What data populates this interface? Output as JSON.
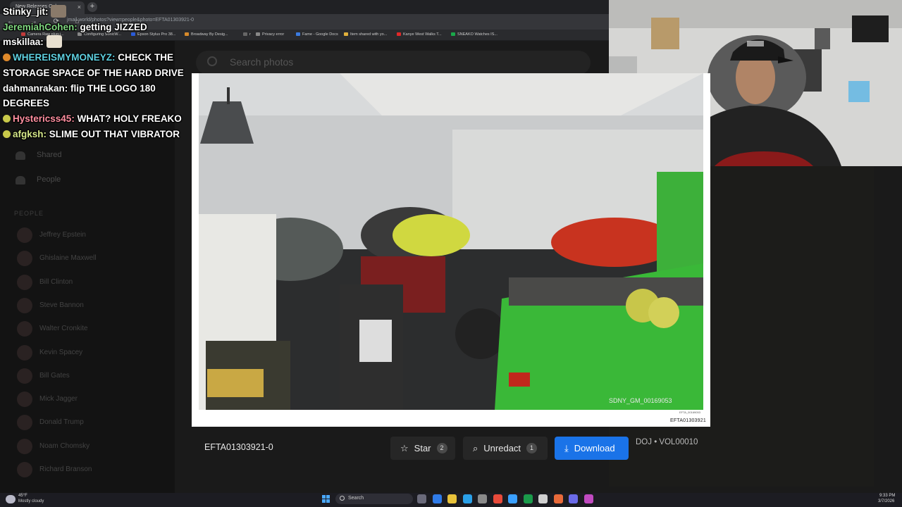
{
  "browser": {
    "tab_title": "New Releases Onl...",
    "new_tab_symbol": "+",
    "close_symbol": "×",
    "nav_symbols": "← → ⟳ ⌂",
    "url": "jmail.world/photos?view=people&photo=EFTA01303921-0",
    "bookmarks": [
      {
        "label": "Camera Raw plug-i...",
        "color": "#c23b3b"
      },
      {
        "label": "Configuring SonicW...",
        "color": "#888888"
      },
      {
        "label": "Epson Stylus Pro 38...",
        "color": "#2a5bd7"
      },
      {
        "label": "Broadway By Desig...",
        "color": "#d68a2a"
      },
      {
        "label": "r",
        "color": "#666666"
      },
      {
        "label": "Privacy error",
        "color": "#888888"
      },
      {
        "label": "Fame - Google Docs",
        "color": "#3b7be0"
      },
      {
        "label": "Item shared with yo...",
        "color": "#e0b03b"
      },
      {
        "label": "Kanye West Walks T...",
        "color": "#e02828"
      },
      {
        "label": "SNEAKO Watches IS...",
        "color": "#1aa84a"
      }
    ]
  },
  "app": {
    "search_placeholder": "Search photos",
    "sidebar": {
      "shared_label": "Shared",
      "people_link_label": "People",
      "section_label": "PEOPLE",
      "people": [
        "Jeffrey Epstein",
        "Ghislaine Maxwell",
        "Bill Clinton",
        "Steve Bannon",
        "Walter Cronkite",
        "Kevin Spacey",
        "Bill Gates",
        "Mick Jagger",
        "Donald Trump",
        "Noam Chomsky",
        "Richard Branson"
      ]
    }
  },
  "chat": [
    {
      "user": "Stinky_jit",
      "sep": ": ",
      "text": "",
      "emote": true
    },
    {
      "user": "JeremiahCohen",
      "sep": ": ",
      "text": "getting JIZZED"
    },
    {
      "user": "mskillaa",
      "sep": ": ",
      "text": "",
      "emote": true
    },
    {
      "user": "WHEREISMYMONEYZ",
      "sep": ": ",
      "text": "CHECK THE STORAGE SPACE OF THE HARD DRIVE",
      "badge": "#e08a2a"
    },
    {
      "user": "dahmanrakan",
      "sep": ": ",
      "text": "flip THE LOGO 180 DEGREES"
    },
    {
      "user": "Hystericss45",
      "sep": ": ",
      "text": "WHAT? HOLY FREAKO",
      "badge": "#c9c94a"
    },
    {
      "user": "afgksh",
      "sep": ": ",
      "text": "SLIME OUT THAT VIBRATOR",
      "badge": "#c9c94a"
    }
  ],
  "viewer": {
    "photo_stamp": "SDNY_GM_00169053",
    "photo_tiny_label": "EFTA_00169053",
    "photo_caption": "EFTA01303921",
    "filename": "EFTA01303921-0",
    "star_label": "Star",
    "star_count": "2",
    "unredact_label": "Unredact",
    "unredact_count": "1",
    "download_label": "Download",
    "meta": "DOJ • VOL00010",
    "icons": {
      "star": "☆",
      "unredact": "⌕",
      "download": "⤓"
    }
  },
  "taskbar": {
    "temperature": "45°F",
    "weather": "Mostly cloudy",
    "search_label": "Search",
    "time": "9:33 PM",
    "date": "3/7/2026",
    "apps": [
      "#6a6a7a",
      "#2f7be8",
      "#e8c23a",
      "#2aa0e8",
      "#8a8a8a",
      "#e84a3a",
      "#3aa0ff",
      "#1a9a4a",
      "#d0d0d0",
      "#e86a3a",
      "#6a6ae8",
      "#c04ac0"
    ]
  }
}
